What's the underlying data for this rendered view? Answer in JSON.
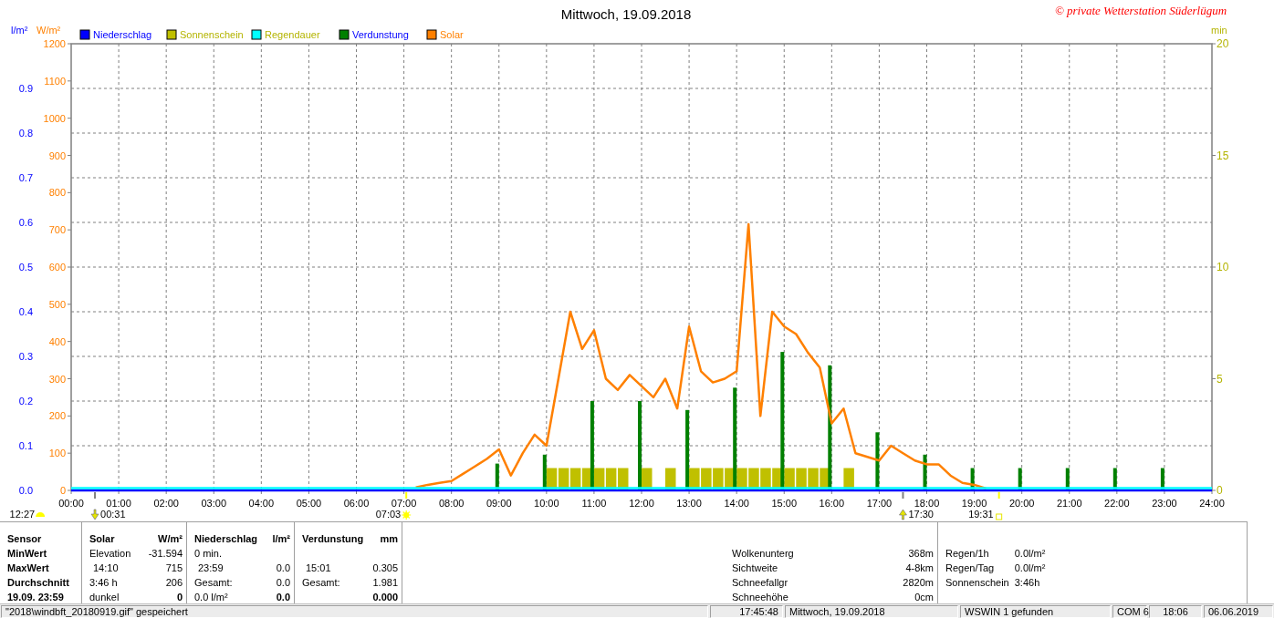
{
  "chart": {
    "chart_data": {
      "type": "line",
      "title": "Mittwoch, 19.09.2018",
      "ylabel": "W/m²",
      "y2label": "l/m²",
      "y3label": "min",
      "xlim": [
        0,
        24
      ],
      "ylim": [
        0,
        1200
      ],
      "y2lim": [
        0,
        1
      ],
      "y3lim": [
        0,
        20
      ],
      "xticks": [
        {
          "value": 0,
          "label": "00:00"
        },
        {
          "value": 1,
          "label": "01:00"
        },
        {
          "value": 2,
          "label": "02:00"
        },
        {
          "value": 3,
          "label": "03:00"
        },
        {
          "value": 4,
          "label": "04:00"
        },
        {
          "value": 5,
          "label": "05:00"
        },
        {
          "value": 6,
          "label": "06:00"
        },
        {
          "value": 7,
          "label": "07:00"
        },
        {
          "value": 8,
          "label": "08:00"
        },
        {
          "value": 9,
          "label": "09:00"
        },
        {
          "value": 10,
          "label": "10:00"
        },
        {
          "value": 11,
          "label": "11:00"
        },
        {
          "value": 12,
          "label": "12:00"
        },
        {
          "value": 13,
          "label": "13:00"
        },
        {
          "value": 14,
          "label": "14:00"
        },
        {
          "value": 15,
          "label": "15:00"
        },
        {
          "value": 16,
          "label": "16:00"
        },
        {
          "value": 17,
          "label": "17:00"
        },
        {
          "value": 18,
          "label": "18:00"
        },
        {
          "value": 19,
          "label": "19:00"
        },
        {
          "value": 20,
          "label": "20:00"
        },
        {
          "value": 21,
          "label": "21:00"
        },
        {
          "value": 22,
          "label": "22:00"
        },
        {
          "value": 23,
          "label": "23:00"
        },
        {
          "value": 24,
          "label": "24:00"
        }
      ],
      "yticks": [
        0,
        100,
        200,
        300,
        400,
        500,
        600,
        700,
        800,
        900,
        1000,
        1100,
        1200
      ],
      "y2ticks": [
        {
          "value": 0,
          "label": "0.0"
        },
        {
          "value": 0.1,
          "label": "0.1"
        },
        {
          "value": 0.2,
          "label": "0.2"
        },
        {
          "value": 0.3,
          "label": "0.3"
        },
        {
          "value": 0.4,
          "label": "0.4"
        },
        {
          "value": 0.5,
          "label": "0.5"
        },
        {
          "value": 0.6,
          "label": "0.6"
        },
        {
          "value": 0.7,
          "label": "0.7"
        },
        {
          "value": 0.8,
          "label": "0.8"
        },
        {
          "value": 0.9,
          "label": "0.9"
        }
      ],
      "y3ticks": [
        0,
        5,
        10,
        15,
        20
      ],
      "x": [
        0,
        0.25,
        0.5,
        0.75,
        1,
        1.25,
        1.5,
        1.75,
        2,
        2.25,
        2.5,
        2.75,
        3,
        3.25,
        3.5,
        3.75,
        4,
        4.25,
        4.5,
        4.75,
        5,
        5.25,
        5.5,
        5.75,
        6,
        6.25,
        6.5,
        6.75,
        7,
        7.25,
        7.5,
        7.75,
        8,
        8.25,
        8.5,
        8.75,
        9,
        9.25,
        9.5,
        9.75,
        10,
        10.25,
        10.5,
        10.75,
        11,
        11.25,
        11.5,
        11.75,
        12,
        12.25,
        12.5,
        12.75,
        13,
        13.25,
        13.5,
        13.75,
        14,
        14.25,
        14.5,
        14.75,
        15,
        15.25,
        15.5,
        15.75,
        16,
        16.25,
        16.5,
        16.75,
        17,
        17.25,
        17.5,
        17.75,
        18,
        18.25,
        18.5,
        18.75,
        19,
        19.25,
        19.5,
        19.75,
        20,
        20.25,
        20.5,
        20.75,
        21,
        21.25,
        21.5,
        21.75,
        22,
        22.25,
        22.5,
        22.75,
        23,
        23.25,
        23.5,
        23.75,
        24
      ],
      "series": [
        {
          "name": "Niederschlag",
          "color": "#0000ff",
          "type": "line",
          "axis": "y2",
          "values": [
            0,
            0,
            0,
            0,
            0,
            0,
            0,
            0,
            0,
            0,
            0,
            0,
            0,
            0,
            0,
            0,
            0,
            0,
            0,
            0,
            0,
            0,
            0,
            0,
            0,
            0,
            0,
            0,
            0,
            0,
            0,
            0,
            0,
            0,
            0,
            0,
            0,
            0,
            0,
            0,
            0,
            0,
            0,
            0,
            0,
            0,
            0,
            0,
            0,
            0,
            0,
            0,
            0,
            0,
            0,
            0,
            0,
            0,
            0,
            0,
            0,
            0,
            0,
            0,
            0,
            0,
            0,
            0,
            0,
            0,
            0,
            0,
            0,
            0,
            0,
            0,
            0,
            0,
            0,
            0,
            0,
            0,
            0,
            0,
            0,
            0,
            0,
            0,
            0,
            0,
            0,
            0,
            0,
            0,
            0,
            0,
            0
          ]
        },
        {
          "name": "Sonnenschein",
          "color": "#c0c000",
          "type": "bar",
          "axis": "y3",
          "values": [
            0,
            0,
            0,
            0,
            0,
            0,
            0,
            0,
            0,
            0,
            0,
            0,
            0,
            0,
            0,
            0,
            0,
            0,
            0,
            0,
            0,
            0,
            0,
            0,
            0,
            0,
            0,
            0,
            0,
            0,
            0,
            0,
            0,
            0,
            0,
            0,
            0,
            0,
            0,
            0,
            1,
            1,
            1,
            1,
            1,
            1,
            1,
            0,
            1,
            0,
            1,
            0,
            1,
            1,
            1,
            1,
            1,
            1,
            1,
            1,
            1,
            1,
            1,
            1,
            0,
            1,
            0,
            0,
            0,
            0,
            0,
            0,
            0,
            0,
            0,
            0,
            0,
            0,
            0,
            0,
            0,
            0,
            0,
            0,
            0,
            0,
            0,
            0,
            0,
            0,
            0,
            0,
            0,
            0,
            0,
            0,
            0
          ]
        },
        {
          "name": "Regendauer",
          "color": "#00ffff",
          "type": "line",
          "axis": "y3",
          "values": [
            0,
            0,
            0,
            0,
            0,
            0,
            0,
            0,
            0,
            0,
            0,
            0,
            0,
            0,
            0,
            0,
            0,
            0,
            0,
            0,
            0,
            0,
            0,
            0,
            0,
            0,
            0,
            0,
            0,
            0,
            0,
            0,
            0,
            0,
            0,
            0,
            0,
            0,
            0,
            0,
            0,
            0,
            0,
            0,
            0,
            0,
            0,
            0,
            0,
            0,
            0,
            0,
            0,
            0,
            0,
            0,
            0,
            0,
            0,
            0,
            0,
            0,
            0,
            0,
            0,
            0,
            0,
            0,
            0,
            0,
            0,
            0,
            0,
            0,
            0,
            0,
            0,
            0,
            0,
            0,
            0,
            0,
            0,
            0,
            0,
            0,
            0,
            0,
            0,
            0,
            0,
            0,
            0,
            0,
            0,
            0,
            0
          ]
        },
        {
          "name": "Verdunstung",
          "color": "#008000",
          "type": "bar",
          "axis": "y2",
          "values": [
            0,
            0,
            0,
            0,
            0,
            0,
            0,
            0,
            0,
            0,
            0,
            0,
            0,
            0,
            0,
            0,
            0,
            0,
            0,
            0,
            0,
            0,
            0,
            0,
            0,
            0,
            0,
            0,
            0,
            0,
            0,
            0,
            0,
            0,
            0,
            0,
            0.06,
            0,
            0,
            0,
            0.08,
            0,
            0,
            0,
            0.2,
            0,
            0,
            0,
            0.2,
            0,
            0,
            0,
            0.18,
            0,
            0,
            0,
            0.23,
            0,
            0,
            0,
            0.31,
            0,
            0,
            0,
            0.28,
            0,
            0,
            0,
            0.13,
            0,
            0,
            0,
            0.08,
            0,
            0,
            0,
            0.05,
            0,
            0,
            0,
            0.05,
            0,
            0,
            0,
            0.05,
            0,
            0,
            0,
            0.05,
            0,
            0,
            0,
            0.05,
            0,
            0,
            0,
            0
          ]
        },
        {
          "name": "Solar",
          "color": "#ff8000",
          "type": "line",
          "values": [
            null,
            null,
            null,
            null,
            null,
            null,
            null,
            null,
            null,
            null,
            null,
            null,
            null,
            null,
            null,
            null,
            null,
            null,
            null,
            null,
            null,
            null,
            null,
            null,
            null,
            null,
            null,
            null,
            null,
            8,
            15,
            20,
            25,
            45,
            65,
            85,
            110,
            40,
            100,
            150,
            120,
            300,
            480,
            380,
            430,
            300,
            270,
            310,
            280,
            250,
            300,
            220,
            440,
            320,
            290,
            300,
            320,
            715,
            200,
            480,
            440,
            420,
            370,
            330,
            180,
            220,
            100,
            90,
            80,
            120,
            100,
            80,
            70,
            70,
            40,
            20,
            15,
            5,
            null,
            null,
            null,
            null,
            null,
            null,
            null,
            null,
            null,
            null,
            null,
            null,
            null,
            null,
            null,
            null,
            null,
            null,
            null
          ]
        }
      ],
      "grid": true,
      "legend": "top"
    },
    "events": [
      {
        "label": "12:27",
        "kind": "moon"
      },
      {
        "label": "00:31",
        "kind": "moonset"
      },
      {
        "label": "07:03",
        "kind": "sunrise"
      },
      {
        "label": "17:30",
        "kind": "moonrise"
      },
      {
        "label": "19:31",
        "kind": "sunset"
      }
    ],
    "copyright": "© private Wetterstation Süderlügum"
  },
  "summary": {
    "row_labels": [
      "Sensor",
      "MinWert",
      "MaxWert",
      "Durchschnitt",
      "19.09. 23:59"
    ],
    "sensors": [
      {
        "name": "Solar",
        "unit": "W/m²",
        "rows": [
          {
            "label": "Elevation",
            "value": "-31.594"
          },
          {
            "label": "14:10",
            "value": "715"
          },
          {
            "label": "3:46 h",
            "value": "206"
          },
          {
            "label": "dunkel",
            "value": "0"
          }
        ]
      },
      {
        "name": "Niederschlag",
        "unit": "l/m²",
        "rows": [
          {
            "label": "0 min."
          },
          {
            "label": "23:59",
            "value": "0.0"
          },
          {
            "label": "Gesamt:",
            "value": "0.0"
          },
          {
            "label": "0.0 l/m²",
            "value": "0.0"
          }
        ]
      },
      {
        "name": "Verdunstung",
        "unit": "mm",
        "rows": [
          {},
          {
            "label": "15:01",
            "value": "0.305"
          },
          {
            "label": "Gesamt:",
            "value": "1.981"
          },
          {
            "value": "0.000"
          }
        ]
      }
    ],
    "weather": [
      {
        "label": "Wolkenunterg",
        "value": "368m"
      },
      {
        "label": "Sichtweite",
        "value": "4-8km"
      },
      {
        "label": "Schneefallgr",
        "value": "2820m"
      },
      {
        "label": "Schneehöhe",
        "value": "0cm"
      }
    ],
    "rain_sun": [
      {
        "label": "Regen/1h",
        "value": "0.0l/m²"
      },
      {
        "label": "Regen/Tag",
        "value": "0.0l/m²"
      },
      {
        "label": "Sonnenschein",
        "value": "3:46h"
      }
    ]
  },
  "status_bar": [
    "\"2018\\windbft_20180919.gif\" gespeichert",
    "17:45:48",
    "Mittwoch, 19.09.2018",
    "WSWIN 1 gefunden",
    "COM 6",
    "18:06",
    "06.06.2019"
  ]
}
